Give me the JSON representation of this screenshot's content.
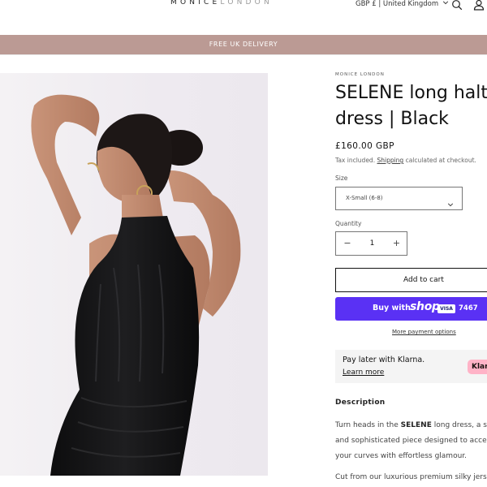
{
  "header": {
    "logo_bold": "MONICE",
    "logo_light": "LONDON",
    "currency": "GBP £ | United Kingdom"
  },
  "announcement": "FREE UK DELIVERY",
  "product": {
    "vendor": "MONICE LONDON",
    "title_line1": "SELENE long halte",
    "title_line2": "dress | Black",
    "price": "£160.00 GBP",
    "tax_prefix": "Tax included.",
    "tax_link": "Shipping",
    "tax_suffix": "calculated at checkout.",
    "size_label": "Size",
    "size_value": "X-Small (6-8)",
    "quantity_label": "Quantity",
    "quantity_minus": "−",
    "quantity_value": "1",
    "quantity_plus": "+",
    "add_to_cart": "Add to cart",
    "shop_pay": {
      "buy_with": "Buy with",
      "shop": "shop",
      "card": "VISA",
      "digits": "7467"
    },
    "more_payment": "More payment options",
    "klarna": {
      "line1": "Pay later with Klarna.",
      "learn_more": "Learn more",
      "badge": "Klar"
    },
    "description_heading": "Description",
    "description_line1_pre": "Turn heads in the ",
    "description_line1_bold": "SELENE",
    "description_line1_post": " long dress, a su",
    "description_line2": "and sophisticated piece designed to accen",
    "description_line3": "your curves with effortless glamour.",
    "description_line4": "Cut from our luxurious premium silky jerse"
  },
  "colors": {
    "announcement_bg": "#bb9a94",
    "shop_pay": "#5a31f4",
    "klarna_pink": "#ffb3c7"
  },
  "icons": [
    "chevron-down-icon",
    "search-icon",
    "account-icon"
  ]
}
